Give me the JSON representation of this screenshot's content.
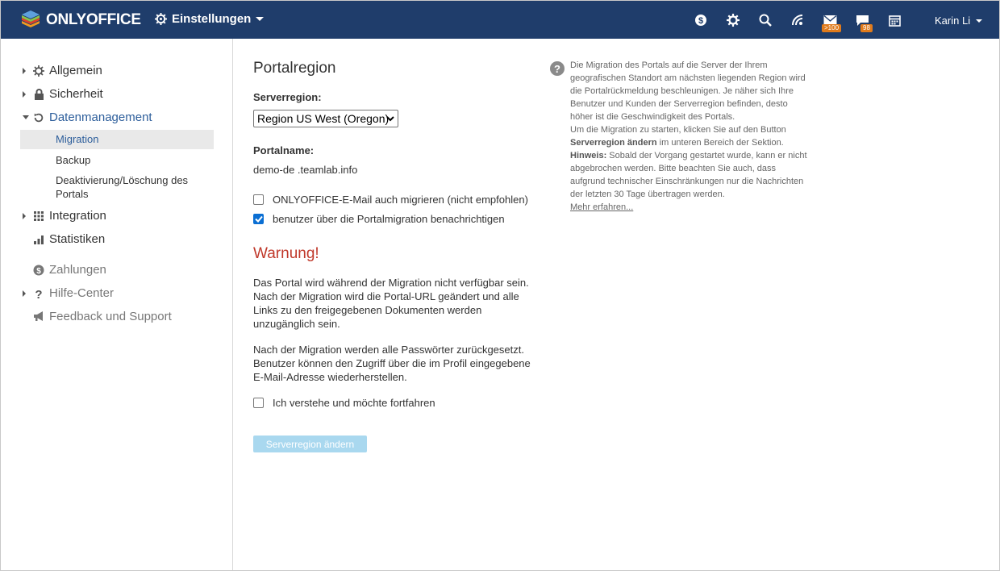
{
  "header": {
    "logo_text": "ONLYOFFICE",
    "module_label": "Einstellungen",
    "icons": [
      "payment-icon",
      "settings-icon",
      "search-icon",
      "feed-icon",
      "mail-icon",
      "talk-icon",
      "calendar-icon"
    ],
    "mail_badge": ">100",
    "talk_badge": "98",
    "user_name": "Karin Li"
  },
  "sidebar": {
    "items": [
      {
        "label": "Allgemein",
        "icon": "gear-icon"
      },
      {
        "label": "Sicherheit",
        "icon": "lock-icon"
      },
      {
        "label": "Datenmanagement",
        "icon": "restore-icon"
      },
      {
        "label": "Integration",
        "icon": "grid-icon"
      },
      {
        "label": "Statistiken",
        "icon": "bar-chart-icon"
      },
      {
        "label": "Zahlungen",
        "icon": "dollar-icon"
      },
      {
        "label": "Hilfe-Center",
        "icon": "question-icon"
      },
      {
        "label": "Feedback und Support",
        "icon": "megaphone-icon"
      }
    ],
    "sub_items": [
      "Migration",
      "Backup",
      "Deaktivierung/Löschung des Portals"
    ]
  },
  "main": {
    "title": "Portalregion",
    "server_region_label": "Serverregion:",
    "server_region_value": "Region US West (Oregon)",
    "portal_name_label": "Portalname:",
    "portal_name_value": "demo-de .teamlab.info",
    "checkbox_mail": "ONLYOFFICE-E-Mail auch migrieren (nicht empfohlen)",
    "checkbox_notify": "benutzer über die Portalmigration benachrichtigen",
    "warning_title": "Warnung!",
    "warning_p1": "Das Portal wird während der Migration nicht verfügbar sein. Nach der Migration wird die Portal-URL geändert und alle Links zu den freigegebenen Dokumenten werden unzugänglich sein.",
    "warning_p2": "Nach der Migration werden alle Passwörter zurückgesetzt. Benutzer können den Zugriff über die im Profil eingegebene E-Mail-Adresse wiederherstellen.",
    "checkbox_confirm": "Ich verstehe und möchte fortfahren",
    "button_label": "Serverregion ändern"
  },
  "help": {
    "text1": "Die Migration des Portals auf die Server der Ihrem geografischen Standort am nächsten liegenden Region wird die Portalrückmeldung beschleunigen. Je näher sich Ihre Benutzer und Kunden der Serverregion befinden, desto höher ist die Geschwindigkeit des Portals.",
    "text2_pre": "Um die Migration zu starten, klicken Sie auf den Button",
    "text2_bold": "Serverregion ändern",
    "text2_post": "im unteren Bereich der Sektion.",
    "note_label": "Hinweis:",
    "note_text": "Sobald der Vorgang gestartet wurde, kann er nicht abgebrochen werden. Bitte beachten Sie auch, dass aufgrund technischer Einschränkungen nur die Nachrichten der letzten 30 Tage übertragen werden.",
    "link": "Mehr erfahren..."
  }
}
